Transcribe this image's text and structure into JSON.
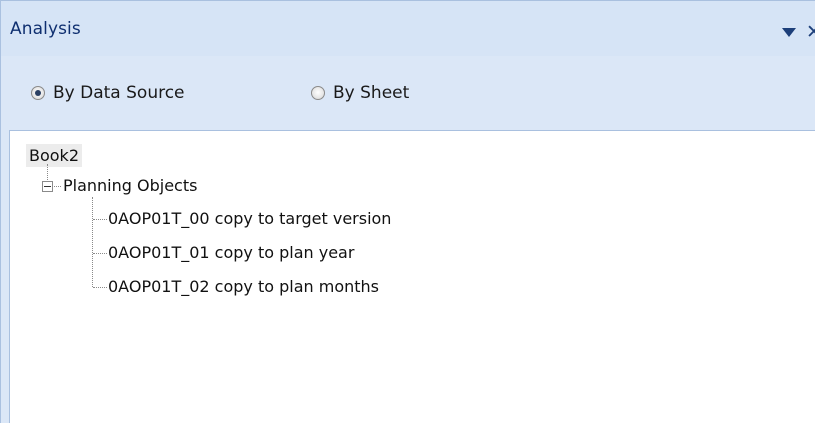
{
  "panel": {
    "title": "Analysis"
  },
  "view_options": {
    "by_data_source": "By Data Source",
    "by_sheet": "By Sheet",
    "selected": "By Data Source"
  },
  "tree": {
    "root": "Book2",
    "group": "Planning Objects",
    "items": [
      "0AOP01T_00 copy to target version",
      "0AOP01T_01 copy to plan year",
      "0AOP01T_02 copy to plan months"
    ]
  },
  "icons": {
    "menu": "dropdown-arrow-icon",
    "close": "close-icon",
    "collapse": "collapse-minus-icon"
  }
}
